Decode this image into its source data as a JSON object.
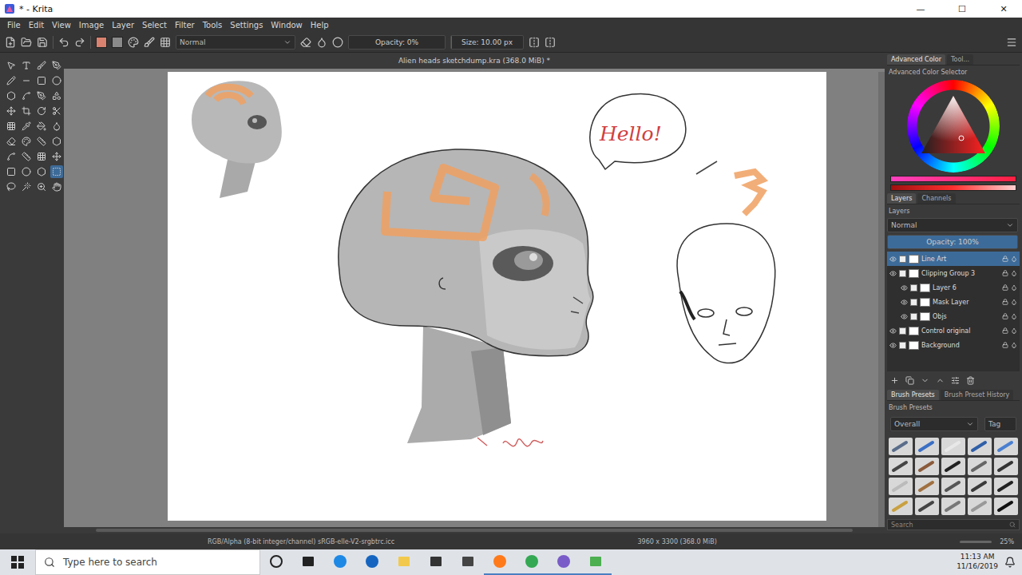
{
  "window": {
    "title": "* - Krita",
    "controls": [
      "—",
      "☐",
      "✕"
    ]
  },
  "menu": [
    "File",
    "Edit",
    "View",
    "Image",
    "Layer",
    "Select",
    "Filter",
    "Tools",
    "Settings",
    "Window",
    "Help"
  ],
  "toolbar": {
    "foreground_color": "#d9826f",
    "background_color": "#8a8a8a",
    "blend_mode": "Normal",
    "opacity": {
      "label": "Opacity: 0%",
      "level": 0
    },
    "size": {
      "label": "Size: 10.00 px",
      "level": 0.01
    }
  },
  "toolbox": {
    "tools": [
      {
        "selected": false
      },
      {
        "selected": false
      },
      {
        "selected": false
      },
      {
        "selected": false
      },
      {
        "selected": false
      },
      {
        "selected": false
      },
      {
        "selected": false
      },
      {
        "selected": false
      },
      {
        "selected": false
      },
      {
        "selected": false
      },
      {
        "selected": false
      },
      {
        "selected": false
      },
      {
        "selected": false
      },
      {
        "selected": false
      },
      {
        "selected": false
      },
      {
        "selected": false
      },
      {
        "selected": false
      },
      {
        "selected": false
      },
      {
        "selected": false
      },
      {
        "selected": false
      },
      {
        "selected": false
      },
      {
        "selected": false
      },
      {
        "selected": false
      },
      {
        "selected": false
      },
      {
        "selected": false
      },
      {
        "selected": false
      },
      {
        "selected": false
      },
      {
        "selected": false
      },
      {
        "selected": false
      },
      {
        "selected": false
      },
      {
        "selected": false
      },
      {
        "selected": true
      },
      {
        "selected": false
      },
      {
        "selected": false
      },
      {
        "selected": false
      },
      {
        "selected": false
      }
    ]
  },
  "document": {
    "title": "Alien heads sketchdump.kra (368.0 MiB) *",
    "speech_bubble": "Hello!"
  },
  "color_docker": {
    "tabs": [
      {
        "label": "Advanced Color",
        "selected": true
      },
      {
        "label": "Tool...",
        "selected": false
      }
    ],
    "title": "Advanced Color Selector"
  },
  "layers_docker": {
    "tabs": [
      {
        "label": "Layers",
        "selected": true
      },
      {
        "label": "Channels",
        "selected": false
      }
    ],
    "title": "Layers",
    "blend_mode": "Normal",
    "opacity": {
      "label": "Opacity: 100%",
      "level": 1
    },
    "layers": [
      {
        "name": "Line Art",
        "depth": 0,
        "visible": true,
        "selected": true
      },
      {
        "name": "Clipping Group 3",
        "depth": 0,
        "visible": true,
        "selected": false
      },
      {
        "name": "Layer 6",
        "depth": 1,
        "visible": true,
        "selected": false
      },
      {
        "name": "Mask Layer",
        "depth": 1,
        "visible": true,
        "selected": false
      },
      {
        "name": "Objs",
        "depth": 1,
        "visible": true,
        "selected": false
      },
      {
        "name": "Control original",
        "depth": 0,
        "visible": true,
        "selected": false
      },
      {
        "name": "Background",
        "depth": 0,
        "visible": true,
        "selected": false
      }
    ]
  },
  "brush_docker": {
    "tabs": [
      {
        "label": "Brush Presets",
        "selected": true
      },
      {
        "label": "Brush Preset History",
        "selected": false
      }
    ],
    "title": "Brush Presets",
    "tag": "Overall",
    "tag_button": "Tag",
    "search": "Search"
  },
  "status_bar": {
    "color_space": "RGB/Alpha (8-bit integer/channel)  sRGB-elle-V2-srgbtrc.icc",
    "image_size": "3960 x 3300 (368.0 MiB)",
    "zoom": "25%"
  },
  "taskbar": {
    "search": "Type here to search",
    "time": "11:13 AM",
    "date": "11/16/2019"
  }
}
